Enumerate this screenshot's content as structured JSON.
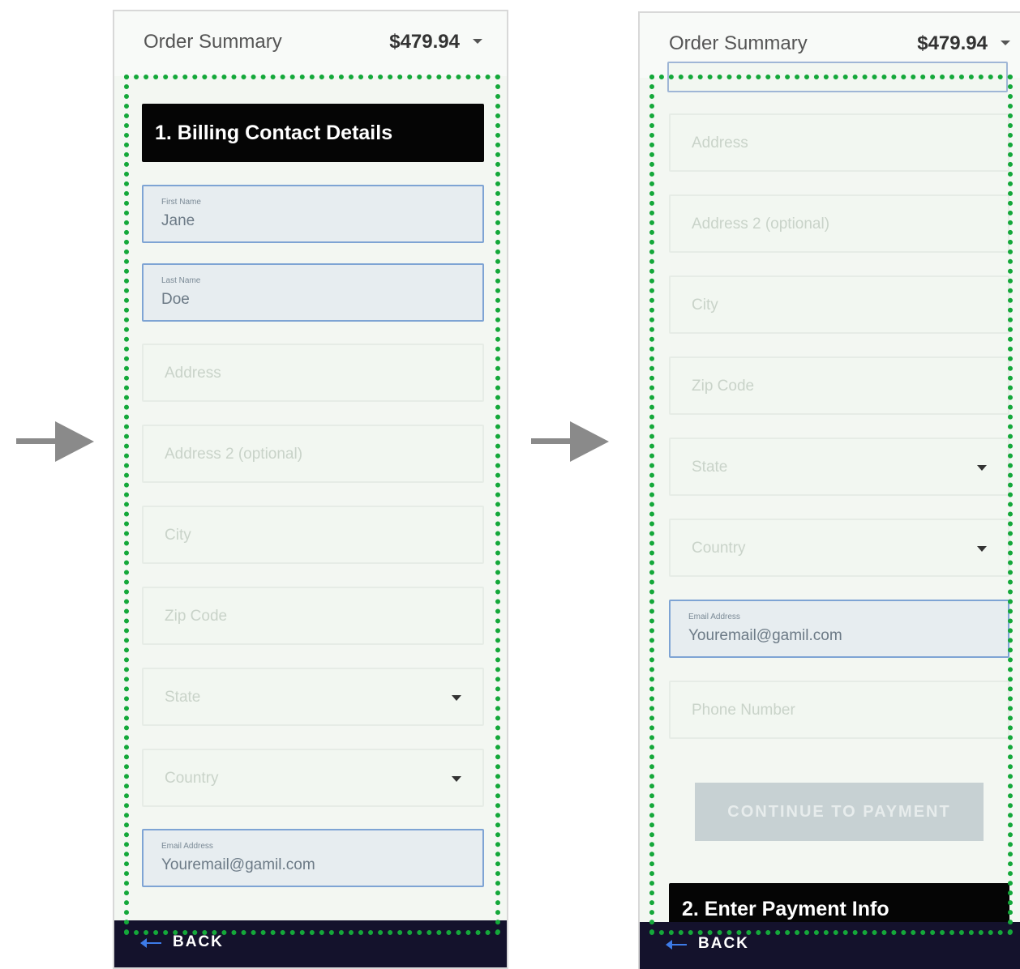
{
  "header": {
    "title": "Order Summary",
    "total": "$479.94"
  },
  "screen1": {
    "section_title": "1. Billing Contact Details",
    "fields": [
      {
        "label": "First Name",
        "value": "Jane"
      },
      {
        "label": "Last Name",
        "value": "Doe"
      },
      {
        "placeholder": "Address"
      },
      {
        "placeholder": "Address 2 (optional)"
      },
      {
        "placeholder": "City"
      },
      {
        "placeholder": "Zip Code"
      },
      {
        "placeholder": "State"
      },
      {
        "placeholder": "Country"
      },
      {
        "label": "Email Address",
        "value": "Youremail@gamil.com"
      }
    ]
  },
  "screen2": {
    "fields": [
      {
        "placeholder": "Address"
      },
      {
        "placeholder": "Address 2 (optional)"
      },
      {
        "placeholder": "City"
      },
      {
        "placeholder": "Zip Code"
      },
      {
        "placeholder": "State"
      },
      {
        "placeholder": "Country"
      },
      {
        "label": "Email Address",
        "value": "Youremail@gamil.com"
      },
      {
        "placeholder": "Phone Number"
      }
    ],
    "continue_label": "CONTINUE TO PAYMENT",
    "next_section_title": "2. Enter Payment Info"
  },
  "footer": {
    "back_label": "BACK"
  },
  "colors": {
    "focus_outline": "#14a83a",
    "footer_bg": "#14122c",
    "section_header_bg": "#050505",
    "filled_field_border": "#7ea4d4"
  }
}
